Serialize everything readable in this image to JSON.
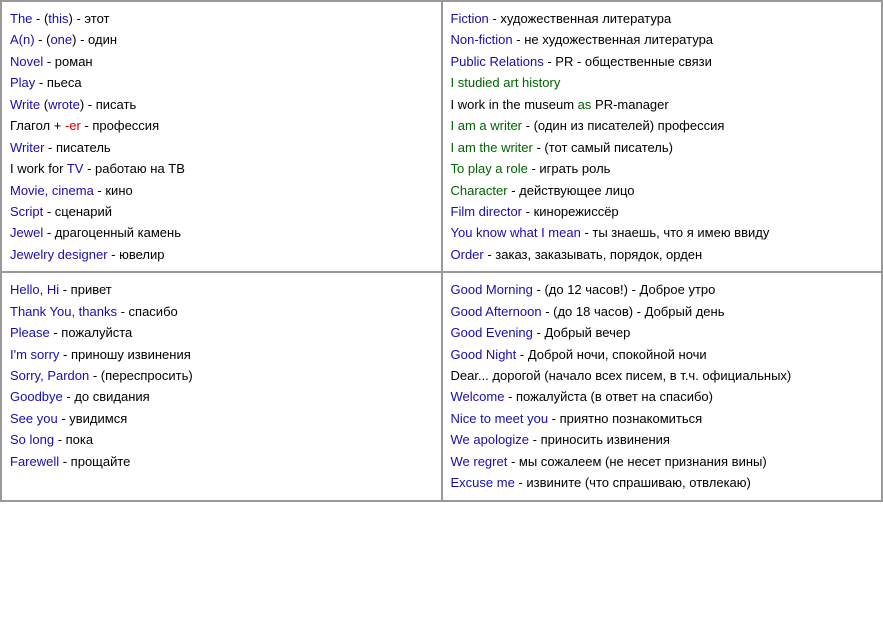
{
  "cells": [
    {
      "id": "top-left",
      "lines": [
        {
          "parts": [
            {
              "text": "The",
              "color": "blue"
            },
            {
              "text": " - (",
              "color": "black"
            },
            {
              "text": "this",
              "color": "blue"
            },
            {
              "text": ") - этот",
              "color": "black"
            }
          ]
        },
        {
          "parts": [
            {
              "text": "A(n)",
              "color": "blue"
            },
            {
              "text": " - (",
              "color": "black"
            },
            {
              "text": "one",
              "color": "blue"
            },
            {
              "text": ") - один",
              "color": "black"
            }
          ]
        },
        {
          "parts": [
            {
              "text": "Novel",
              "color": "blue"
            },
            {
              "text": " - роман",
              "color": "black"
            }
          ]
        },
        {
          "parts": [
            {
              "text": "Play",
              "color": "blue"
            },
            {
              "text": " - пьеса",
              "color": "black"
            }
          ]
        },
        {
          "parts": [
            {
              "text": "Write",
              "color": "blue"
            },
            {
              "text": " (",
              "color": "black"
            },
            {
              "text": "wrote",
              "color": "blue"
            },
            {
              "text": ") - писать",
              "color": "black"
            }
          ]
        },
        {
          "parts": [
            {
              "text": "Глагол + ",
              "color": "black"
            },
            {
              "text": "-er",
              "color": "red"
            },
            {
              "text": " - профессия",
              "color": "black"
            }
          ]
        },
        {
          "parts": [
            {
              "text": "Writer",
              "color": "blue"
            },
            {
              "text": " - писатель",
              "color": "black"
            }
          ]
        },
        {
          "parts": [
            {
              "text": "I work for ",
              "color": "black"
            },
            {
              "text": "TV",
              "color": "blue"
            },
            {
              "text": " - работаю на ТВ",
              "color": "black"
            }
          ]
        },
        {
          "parts": [
            {
              "text": "Movie, cinema",
              "color": "blue"
            },
            {
              "text": " - кино",
              "color": "black"
            }
          ]
        },
        {
          "parts": [
            {
              "text": "Script",
              "color": "blue"
            },
            {
              "text": " - сценарий",
              "color": "black"
            }
          ]
        },
        {
          "parts": [
            {
              "text": "Jewel",
              "color": "blue"
            },
            {
              "text": " - драгоценный камень",
              "color": "black"
            }
          ]
        },
        {
          "parts": [
            {
              "text": "Jewelry designer",
              "color": "blue"
            },
            {
              "text": " - ювелир",
              "color": "black"
            }
          ]
        }
      ]
    },
    {
      "id": "top-right",
      "lines": [
        {
          "parts": [
            {
              "text": "Fiction",
              "color": "blue"
            },
            {
              "text": " - художественная литература",
              "color": "black"
            }
          ]
        },
        {
          "parts": [
            {
              "text": "Non-fiction",
              "color": "blue"
            },
            {
              "text": " - не художественная литература",
              "color": "black"
            }
          ]
        },
        {
          "parts": [
            {
              "text": "Public Relations",
              "color": "blue"
            },
            {
              "text": " - PR - общественные связи",
              "color": "black"
            }
          ]
        },
        {
          "parts": [
            {
              "text": "I studied art history",
              "color": "green"
            }
          ]
        },
        {
          "parts": [
            {
              "text": "I work in",
              "color": "black"
            },
            {
              "text": " the museum ",
              "color": "black"
            },
            {
              "text": "as",
              "color": "green"
            },
            {
              "text": " PR-manager",
              "color": "black"
            }
          ]
        },
        {
          "parts": [
            {
              "text": "I am a writer",
              "color": "green"
            },
            {
              "text": " - (один из писателей) профессия",
              "color": "black"
            }
          ]
        },
        {
          "parts": [
            {
              "text": "I am the writer",
              "color": "green"
            },
            {
              "text": " - (тот самый писатель)",
              "color": "black"
            }
          ]
        },
        {
          "parts": [
            {
              "text": "To play a role",
              "color": "green"
            },
            {
              "text": " - играть роль",
              "color": "black"
            }
          ]
        },
        {
          "parts": [
            {
              "text": "Character",
              "color": "green"
            },
            {
              "text": " - действующее лицо",
              "color": "black"
            }
          ]
        },
        {
          "parts": [
            {
              "text": "Film director",
              "color": "blue"
            },
            {
              "text": " - кинорежиссёр",
              "color": "black"
            }
          ]
        },
        {
          "parts": [
            {
              "text": "You know what I mean",
              "color": "blue"
            },
            {
              "text": " - ты знаешь, что я имею ввиду",
              "color": "black"
            }
          ]
        },
        {
          "parts": [
            {
              "text": "Order",
              "color": "blue"
            },
            {
              "text": " - заказ, заказывать, порядок, орден",
              "color": "black"
            }
          ]
        }
      ]
    },
    {
      "id": "bottom-left",
      "lines": [
        {
          "parts": [
            {
              "text": "Hello, Hi",
              "color": "blue"
            },
            {
              "text": " - привет",
              "color": "black"
            }
          ]
        },
        {
          "parts": [
            {
              "text": "Thank You, thanks",
              "color": "blue"
            },
            {
              "text": " - спасибо",
              "color": "black"
            }
          ]
        },
        {
          "parts": [
            {
              "text": "Please",
              "color": "blue"
            },
            {
              "text": " - пожалуйста",
              "color": "black"
            }
          ]
        },
        {
          "parts": [
            {
              "text": "I'm sorry",
              "color": "blue"
            },
            {
              "text": " - приношу извинения",
              "color": "black"
            }
          ]
        },
        {
          "parts": [
            {
              "text": "Sorry, Pardon",
              "color": "blue"
            },
            {
              "text": " - (переспросить)",
              "color": "black"
            }
          ]
        },
        {
          "parts": [
            {
              "text": "Goodbye",
              "color": "blue"
            },
            {
              "text": " - до свидания",
              "color": "black"
            }
          ]
        },
        {
          "parts": [
            {
              "text": "See you",
              "color": "blue"
            },
            {
              "text": " - увидимся",
              "color": "black"
            }
          ]
        },
        {
          "parts": [
            {
              "text": "So long",
              "color": "blue"
            },
            {
              "text": " - пока",
              "color": "black"
            }
          ]
        },
        {
          "parts": [
            {
              "text": "Farewell",
              "color": "blue"
            },
            {
              "text": " - прощайте",
              "color": "black"
            }
          ]
        }
      ]
    },
    {
      "id": "bottom-right",
      "lines": [
        {
          "parts": [
            {
              "text": "Good Morning",
              "color": "blue"
            },
            {
              "text": " - (до 12 часов!) - Доброе утро",
              "color": "black"
            }
          ]
        },
        {
          "parts": [
            {
              "text": "Good Afternoon",
              "color": "blue"
            },
            {
              "text": " - (до 18 часов) - Добрый день",
              "color": "black"
            }
          ]
        },
        {
          "parts": [
            {
              "text": "Good Evening",
              "color": "blue"
            },
            {
              "text": " - Добрый вечер",
              "color": "black"
            }
          ]
        },
        {
          "parts": [
            {
              "text": "Good Night",
              "color": "blue"
            },
            {
              "text": " - Доброй ночи, спокойной ночи",
              "color": "black"
            }
          ]
        },
        {
          "parts": [
            {
              "text": "Dear...",
              "color": "black"
            },
            {
              "text": " дорогой (начало всех писем, в т.ч. официальных)",
              "color": "black"
            }
          ]
        },
        {
          "parts": [
            {
              "text": "Welcome",
              "color": "blue"
            },
            {
              "text": " - пожалуйста (в ответ на спасибо)",
              "color": "black"
            }
          ]
        },
        {
          "parts": [
            {
              "text": "Nice to meet you",
              "color": "blue"
            },
            {
              "text": " - приятно познакомиться",
              "color": "black"
            }
          ]
        },
        {
          "parts": [
            {
              "text": "We apologize",
              "color": "blue"
            },
            {
              "text": " - приносить извинения",
              "color": "black"
            }
          ]
        },
        {
          "parts": [
            {
              "text": "We regret",
              "color": "blue"
            },
            {
              "text": " - мы сожалеем (не несет признания вины)",
              "color": "black"
            }
          ]
        },
        {
          "parts": [
            {
              "text": "Excuse me",
              "color": "blue"
            },
            {
              "text": " - извините (что спрашиваю, отвлекаю)",
              "color": "black"
            }
          ]
        }
      ]
    }
  ]
}
